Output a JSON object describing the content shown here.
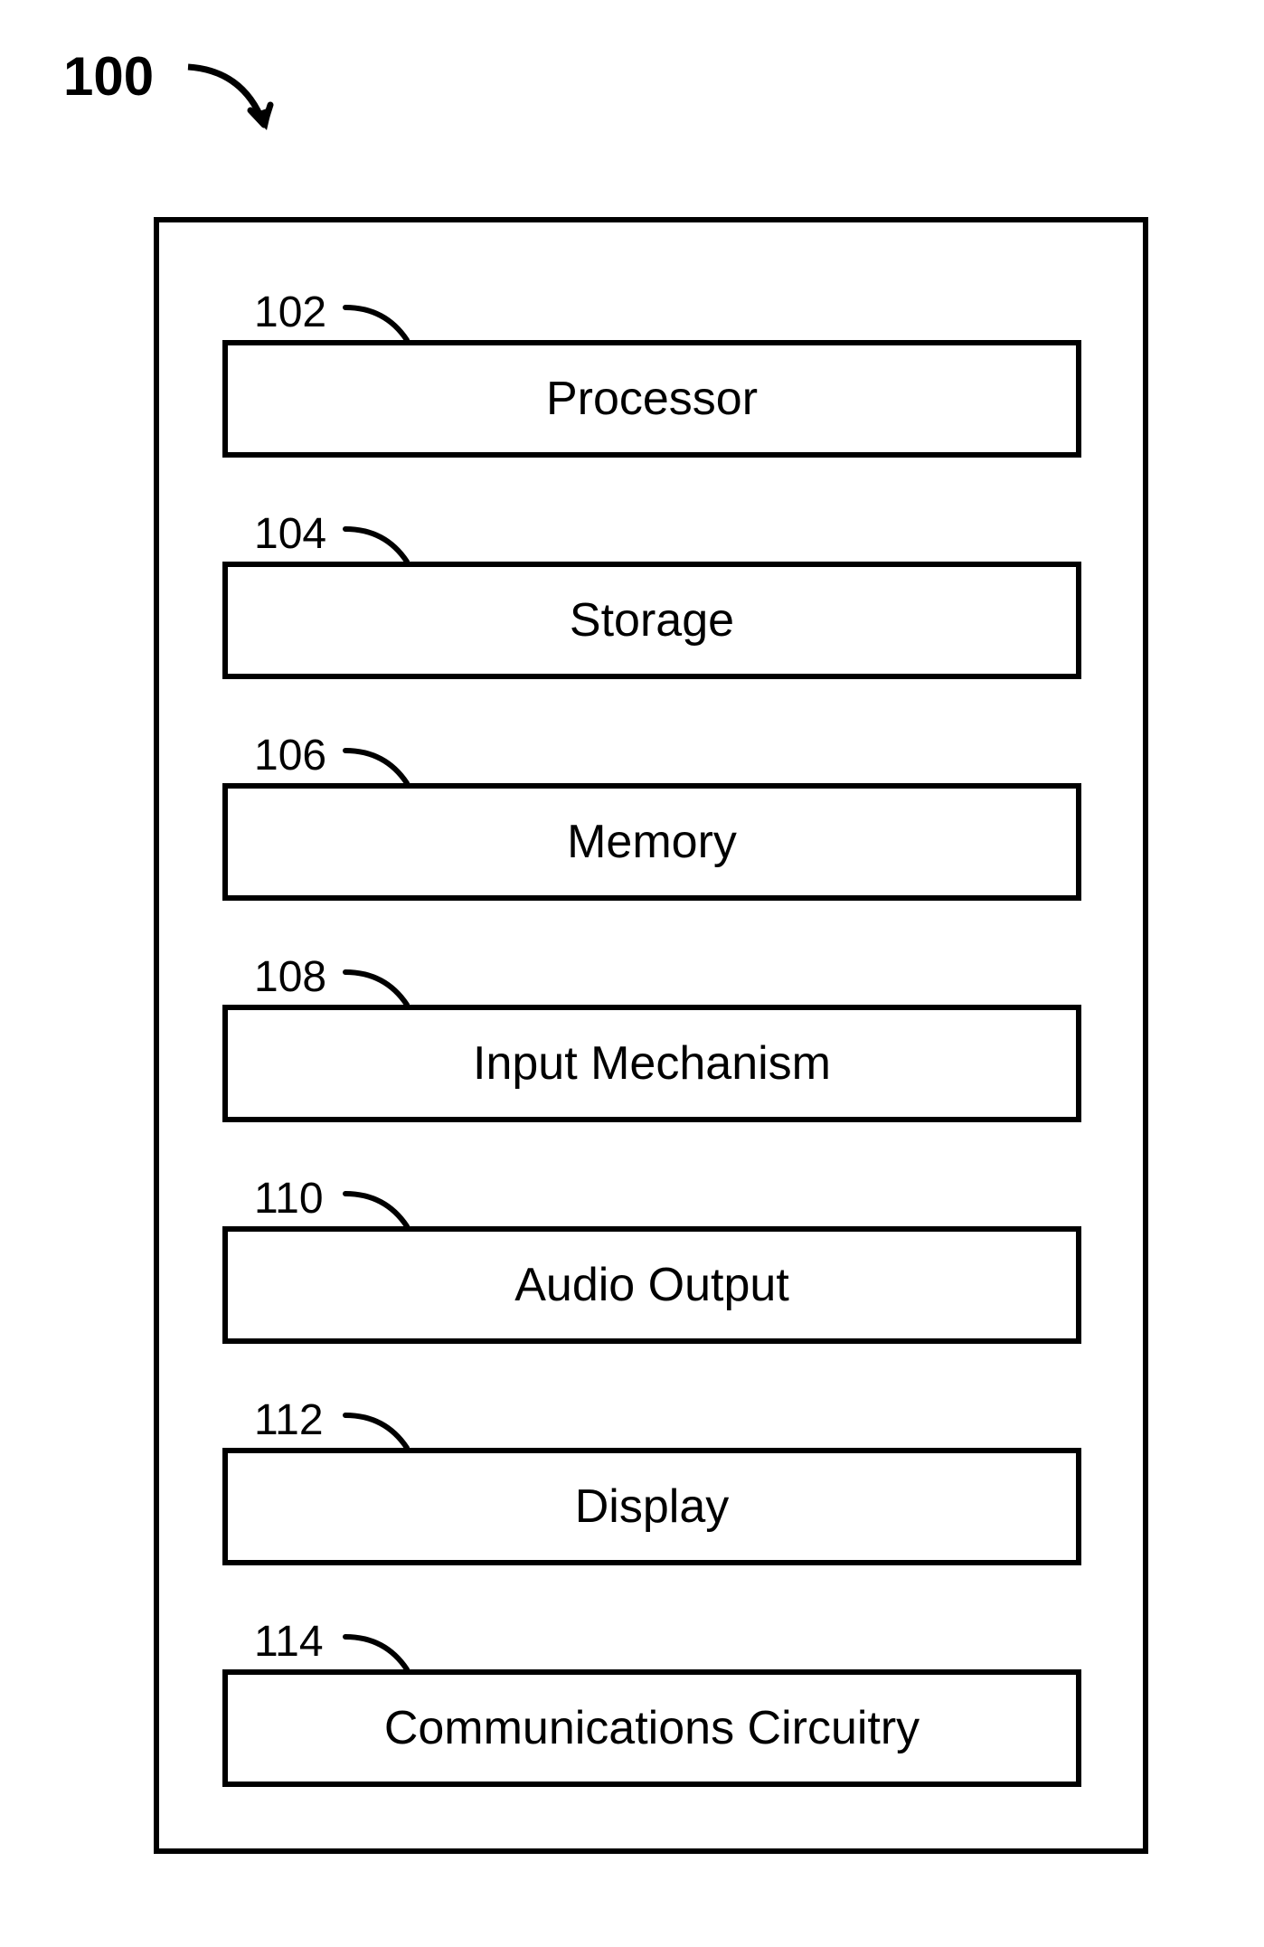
{
  "figure": {
    "reference": "100"
  },
  "components": [
    {
      "ref": "102",
      "label": "Processor"
    },
    {
      "ref": "104",
      "label": "Storage"
    },
    {
      "ref": "106",
      "label": "Memory"
    },
    {
      "ref": "108",
      "label": "Input Mechanism"
    },
    {
      "ref": "110",
      "label": "Audio Output"
    },
    {
      "ref": "112",
      "label": "Display"
    },
    {
      "ref": "114",
      "label": "Communications Circuitry"
    }
  ]
}
